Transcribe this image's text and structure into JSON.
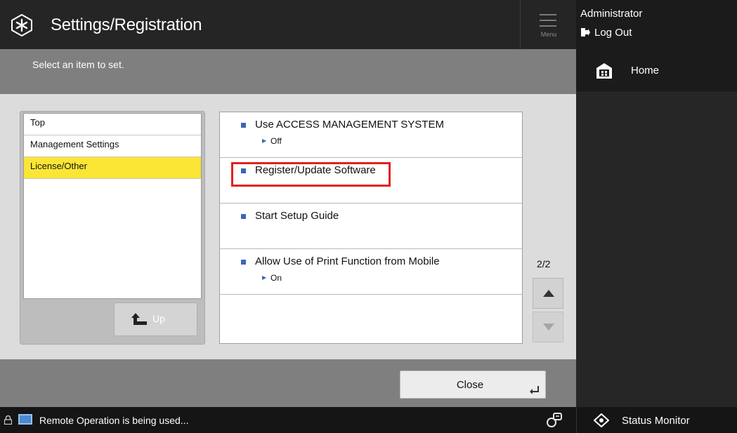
{
  "header": {
    "title": "Settings/Registration",
    "menu_label": "Menu"
  },
  "user": {
    "name": "Administrator",
    "logout_label": "Log Out"
  },
  "home": {
    "label": "Home"
  },
  "subheader": {
    "instruction": "Select an item to set."
  },
  "tree": {
    "items": [
      {
        "label": "Top",
        "selected": false
      },
      {
        "label": "Management Settings",
        "selected": false
      },
      {
        "label": "License/Other",
        "selected": true
      }
    ],
    "up_label": "Up"
  },
  "settings_list": {
    "items": [
      {
        "label": "Use ACCESS MANAGEMENT SYSTEM",
        "value": "Off"
      },
      {
        "label": "Register/Update Software",
        "value": "",
        "highlighted": true
      },
      {
        "label": "Start Setup Guide",
        "value": ""
      },
      {
        "label": "Allow Use of Print Function from Mobile",
        "value": "On"
      }
    ]
  },
  "pagination": {
    "indicator": "2/2"
  },
  "footer": {
    "close_label": "Close"
  },
  "status_bar": {
    "message": "Remote Operation is being used...",
    "status_monitor_label": "Status Monitor"
  },
  "colors": {
    "selected_row": "#fbe636",
    "highlight_border": "#e32020",
    "bullet": "#3a66b5"
  }
}
